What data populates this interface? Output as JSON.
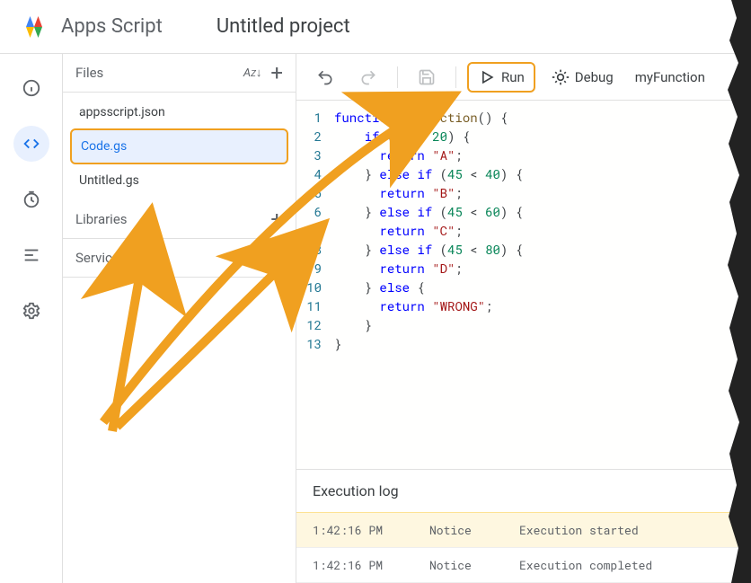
{
  "header": {
    "app_name": "Apps Script",
    "project_title": "Untitled project"
  },
  "files_panel": {
    "title": "Files",
    "items": [
      "appsscript.json",
      "Code.gs",
      "Untitled.gs"
    ],
    "selected_index": 1,
    "libraries_label": "Libraries",
    "services_label": "Services"
  },
  "toolbar": {
    "run_label": "Run",
    "debug_label": "Debug",
    "function_name": "myFunction"
  },
  "code": {
    "line_count": 13,
    "lines": [
      {
        "n": 1,
        "tokens": [
          {
            "t": "function ",
            "c": "kw"
          },
          {
            "t": "myFunction",
            "c": "fn"
          },
          {
            "t": "() {",
            "c": ""
          }
        ]
      },
      {
        "n": 2,
        "tokens": [
          {
            "t": "    ",
            "c": ""
          },
          {
            "t": "if",
            "c": "kw"
          },
          {
            "t": " (",
            "c": ""
          },
          {
            "t": "45",
            "c": "num"
          },
          {
            "t": " < ",
            "c": ""
          },
          {
            "t": "20",
            "c": "num"
          },
          {
            "t": ") {",
            "c": ""
          }
        ]
      },
      {
        "n": 3,
        "tokens": [
          {
            "t": "      ",
            "c": ""
          },
          {
            "t": "return",
            "c": "kw"
          },
          {
            "t": " ",
            "c": ""
          },
          {
            "t": "\"A\"",
            "c": "str"
          },
          {
            "t": ";",
            "c": ""
          }
        ]
      },
      {
        "n": 4,
        "tokens": [
          {
            "t": "    } ",
            "c": ""
          },
          {
            "t": "else if",
            "c": "kw"
          },
          {
            "t": " (",
            "c": ""
          },
          {
            "t": "45",
            "c": "num"
          },
          {
            "t": " < ",
            "c": ""
          },
          {
            "t": "40",
            "c": "num"
          },
          {
            "t": ") {",
            "c": ""
          }
        ]
      },
      {
        "n": 5,
        "tokens": [
          {
            "t": "      ",
            "c": ""
          },
          {
            "t": "return",
            "c": "kw"
          },
          {
            "t": " ",
            "c": ""
          },
          {
            "t": "\"B\"",
            "c": "str"
          },
          {
            "t": ";",
            "c": ""
          }
        ]
      },
      {
        "n": 6,
        "tokens": [
          {
            "t": "    } ",
            "c": ""
          },
          {
            "t": "else if",
            "c": "kw"
          },
          {
            "t": " (",
            "c": ""
          },
          {
            "t": "45",
            "c": "num"
          },
          {
            "t": " < ",
            "c": ""
          },
          {
            "t": "60",
            "c": "num"
          },
          {
            "t": ") {",
            "c": ""
          }
        ]
      },
      {
        "n": 7,
        "tokens": [
          {
            "t": "      ",
            "c": ""
          },
          {
            "t": "return",
            "c": "kw"
          },
          {
            "t": " ",
            "c": ""
          },
          {
            "t": "\"C\"",
            "c": "str"
          },
          {
            "t": ";",
            "c": ""
          }
        ]
      },
      {
        "n": 8,
        "tokens": [
          {
            "t": "    } ",
            "c": ""
          },
          {
            "t": "else if",
            "c": "kw"
          },
          {
            "t": " (",
            "c": ""
          },
          {
            "t": "45",
            "c": "num"
          },
          {
            "t": " < ",
            "c": ""
          },
          {
            "t": "80",
            "c": "num"
          },
          {
            "t": ") {",
            "c": ""
          }
        ]
      },
      {
        "n": 9,
        "tokens": [
          {
            "t": "      ",
            "c": ""
          },
          {
            "t": "return",
            "c": "kw"
          },
          {
            "t": " ",
            "c": ""
          },
          {
            "t": "\"D\"",
            "c": "str"
          },
          {
            "t": ";",
            "c": ""
          }
        ]
      },
      {
        "n": 10,
        "tokens": [
          {
            "t": "    } ",
            "c": ""
          },
          {
            "t": "else",
            "c": "kw"
          },
          {
            "t": " {",
            "c": ""
          }
        ]
      },
      {
        "n": 11,
        "tokens": [
          {
            "t": "      ",
            "c": ""
          },
          {
            "t": "return",
            "c": "kw"
          },
          {
            "t": " ",
            "c": ""
          },
          {
            "t": "\"WRONG\"",
            "c": "str"
          },
          {
            "t": ";",
            "c": ""
          }
        ]
      },
      {
        "n": 12,
        "tokens": [
          {
            "t": "    }",
            "c": ""
          }
        ]
      },
      {
        "n": 13,
        "tokens": [
          {
            "t": "}",
            "c": ""
          }
        ]
      }
    ]
  },
  "execution": {
    "title": "Execution log",
    "rows": [
      {
        "time": "1:42:16 PM",
        "level": "Notice",
        "msg": "Execution started"
      },
      {
        "time": "1:42:16 PM",
        "level": "Notice",
        "msg": "Execution completed"
      }
    ]
  }
}
